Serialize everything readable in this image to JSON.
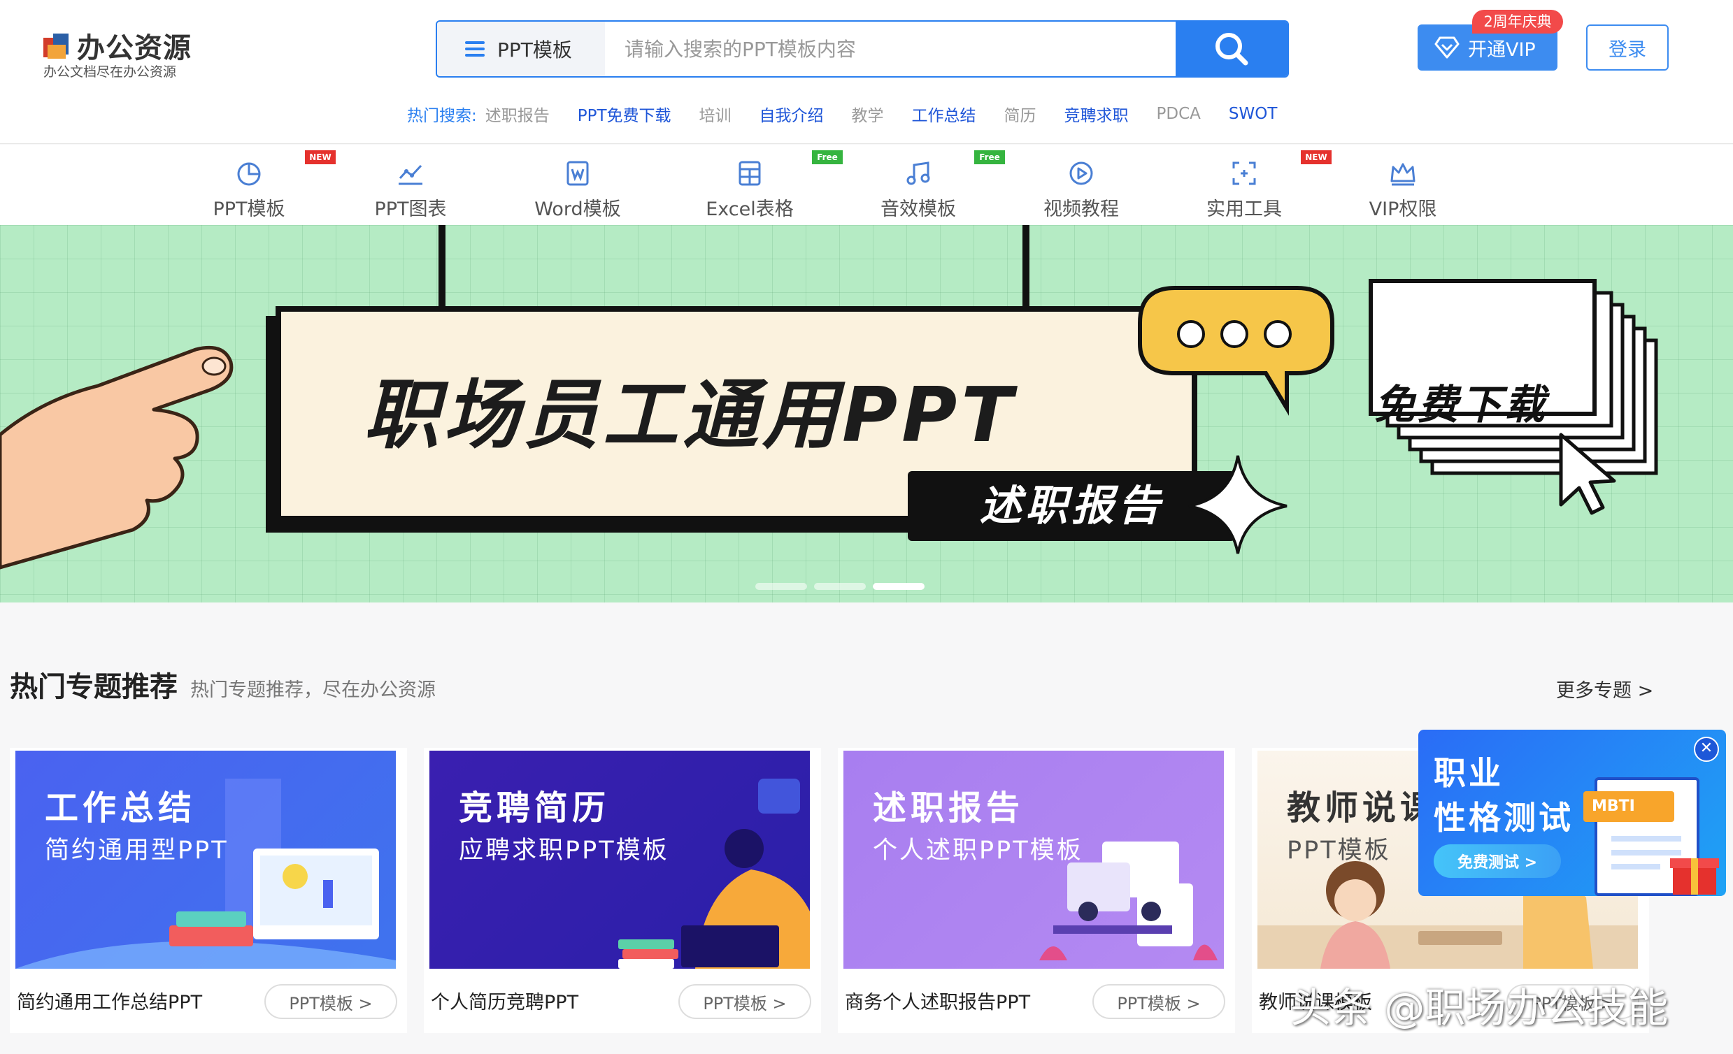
{
  "brand": {
    "name": "办公资源",
    "tagline": "办公文档尽在办公资源"
  },
  "search": {
    "category": "PPT模板",
    "placeholder": "请输入搜索的PPT模板内容"
  },
  "hot_search": {
    "label": "热门搜索:",
    "items": [
      {
        "text": "述职报告",
        "style": "gray"
      },
      {
        "text": "PPT免费下载",
        "style": "blue"
      },
      {
        "text": "培训",
        "style": "gray"
      },
      {
        "text": "自我介绍",
        "style": "blue"
      },
      {
        "text": "教学",
        "style": "gray"
      },
      {
        "text": "工作总结",
        "style": "blue"
      },
      {
        "text": "简历",
        "style": "gray"
      },
      {
        "text": "竞聘求职",
        "style": "blue"
      },
      {
        "text": "PDCA",
        "style": "gray"
      },
      {
        "text": "SWOT",
        "style": "blue"
      }
    ]
  },
  "header_actions": {
    "vip_badge": "2周年庆典",
    "vip_label": "开通VIP",
    "login_label": "登录"
  },
  "nav": [
    {
      "label": "PPT模板",
      "icon": "pie-chart-icon",
      "badge": "NEW"
    },
    {
      "label": "PPT图表",
      "icon": "line-chart-icon",
      "badge": ""
    },
    {
      "label": "Word模板",
      "icon": "word-doc-icon",
      "badge": ""
    },
    {
      "label": "Excel表格",
      "icon": "calculator-icon",
      "badge": "Free"
    },
    {
      "label": "音效模板",
      "icon": "music-note-icon",
      "badge": "Free"
    },
    {
      "label": "视频教程",
      "icon": "play-circle-icon",
      "badge": ""
    },
    {
      "label": "实用工具",
      "icon": "tools-icon",
      "badge": "NEW"
    },
    {
      "label": "VIP权限",
      "icon": "crown-icon",
      "badge": ""
    }
  ],
  "banner": {
    "title": "职场员工通用PPT",
    "subtitle": "述职报告",
    "download": "免费下载",
    "slides": 3,
    "active_slide": 3
  },
  "section": {
    "heading": "热门专题推荐",
    "subheading": "热门专题推荐，尽在办公资源",
    "more": "更多专题 >"
  },
  "cards": [
    {
      "title": "工作总结",
      "subtitle": "简约通用型PPT",
      "name": "简约通用工作总结PPT",
      "tag": "PPT模板 >",
      "color": "#4a62f0"
    },
    {
      "title": "竞聘简历",
      "subtitle": "应聘求职PPT模板",
      "name": "个人简历竞聘PPT",
      "tag": "PPT模板 >",
      "color": "#3a1fb0"
    },
    {
      "title": "述职报告",
      "subtitle": "个人述职PPT模板",
      "name": "商务个人述职报告PPT",
      "tag": "PPT模板 >",
      "color": "#a87ef0"
    },
    {
      "title": "教师说课",
      "subtitle": "PPT模板",
      "name": "教师说课模板",
      "tag": "PPT模板 >",
      "color": "#fbf3e6"
    }
  ],
  "popup": {
    "line1": "职业",
    "line2": "性格测试",
    "button": "免费测试 >",
    "tag": "MBTI"
  },
  "watermark": "头条 @职场办公技能"
}
